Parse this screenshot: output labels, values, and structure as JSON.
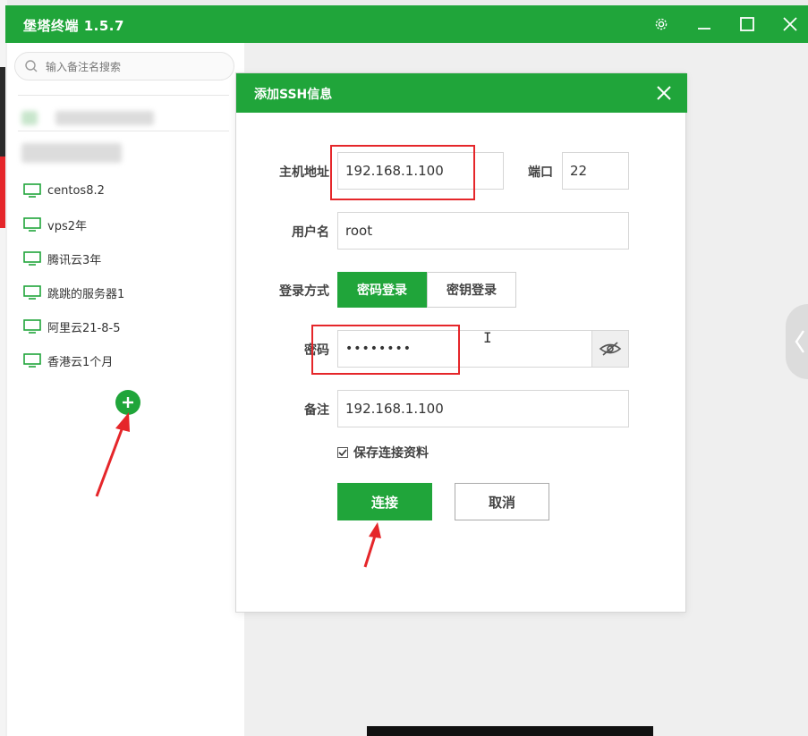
{
  "app": {
    "title": "堡塔终端 1.5.7",
    "accent": "#20a53a"
  },
  "titlebar": {
    "icons": [
      "gear-icon",
      "minimize-icon",
      "maximize-icon",
      "close-icon"
    ]
  },
  "sidebar": {
    "search_placeholder": "输入备注名搜索",
    "hosts": [
      {
        "label": "centos8.2"
      },
      {
        "label": "vps2年"
      },
      {
        "label": "腾讯云3年"
      },
      {
        "label": "跳跳的服务器1"
      },
      {
        "label": "阿里云21-8-5"
      },
      {
        "label": "香港云1个月"
      }
    ]
  },
  "dialog": {
    "title": "添加SSH信息",
    "host_label": "主机地址",
    "host_value": "192.168.1.100",
    "port_label": "端口",
    "port_value": "22",
    "user_label": "用户名",
    "user_value": "root",
    "login_label": "登录方式",
    "login_password": "密码登录",
    "login_key": "密钥登录",
    "password_label": "密码",
    "password_value": "••••••••",
    "note_label": "备注",
    "note_value": "192.168.1.100",
    "save_label": "保存连接资料",
    "connect_label": "连接",
    "cancel_label": "取消"
  },
  "annotation_color": "#e5262a"
}
